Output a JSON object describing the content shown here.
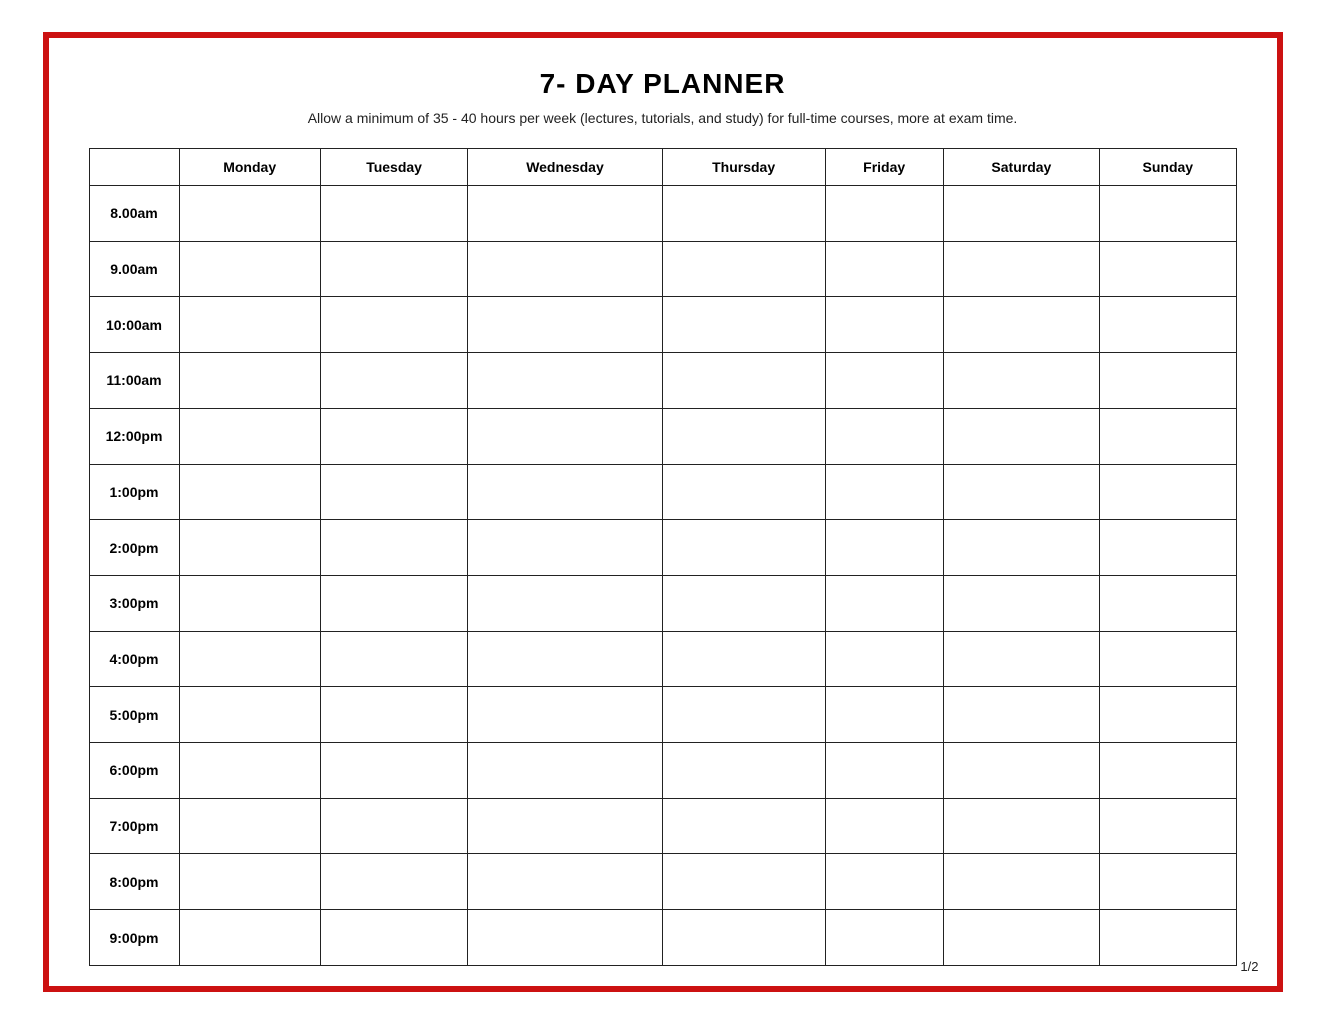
{
  "page": {
    "title": "7- DAY PLANNER",
    "subtitle": "Allow a minimum of 35 - 40 hours per week (lectures, tutorials, and study) for full-time courses, more at exam time.",
    "page_number": "1/2"
  },
  "table": {
    "headers": [
      "",
      "Monday",
      "Tuesday",
      "Wednesday",
      "Thursday",
      "Friday",
      "Saturday",
      "Sunday"
    ],
    "time_slots": [
      "8.00am",
      "9.00am",
      "10:00am",
      "11:00am",
      "12:00pm",
      "1:00pm",
      "2:00pm",
      "3:00pm",
      "4:00pm",
      "5:00pm",
      "6:00pm",
      "7:00pm",
      "8:00pm",
      "9:00pm"
    ]
  }
}
